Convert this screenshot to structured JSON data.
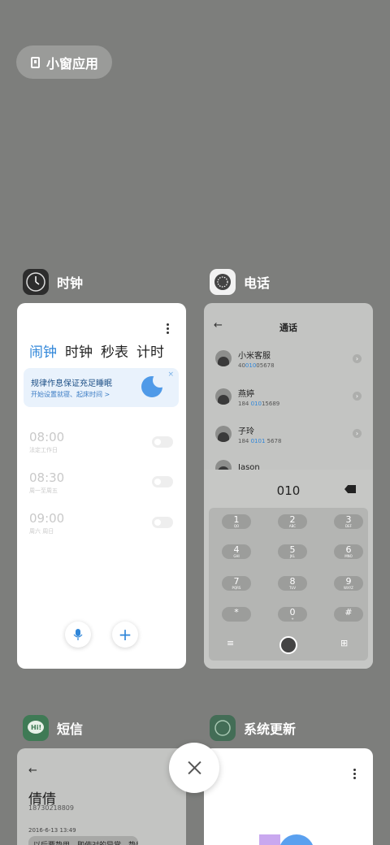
{
  "float_window": {
    "label": "小窗应用"
  },
  "apps": {
    "clock": {
      "name": "时钟"
    },
    "phone": {
      "name": "电话"
    },
    "sms": {
      "name": "短信"
    },
    "update": {
      "name": "系统更新"
    }
  },
  "clock_card": {
    "tabs": [
      "闹钟",
      "时钟",
      "秒表",
      "计时"
    ],
    "active_tab": "闹钟",
    "banner": {
      "title": "规律作息保证充足睡眠",
      "subtitle": "开始设置就寝、起床时间 >",
      "close": "×"
    },
    "alarms": [
      {
        "time": "08:00",
        "repeat": "法定工作日",
        "enabled": false
      },
      {
        "time": "08:30",
        "repeat": "周一至周五",
        "enabled": false
      },
      {
        "time": "09:00",
        "repeat": "周六 周日",
        "enabled": false
      }
    ],
    "add_label": "+"
  },
  "phone_card": {
    "back": "←",
    "title": "通话",
    "contacts": [
      {
        "name": "小米客服",
        "num_pre": "40",
        "num_hl": "010",
        "num_post": "05678"
      },
      {
        "name": "燕婷",
        "num_pre": "184 ",
        "num_hl": "010",
        "num_post": "15689"
      },
      {
        "name": "子玲",
        "num_pre": "184 ",
        "num_hl": "0101",
        "num_post": " 5678"
      },
      {
        "name": "Jason",
        "num_pre": "",
        "num_hl": "",
        "num_post": ""
      }
    ],
    "dialed": "010",
    "keys": [
      {
        "d": "1",
        "l": "QO"
      },
      {
        "d": "2",
        "l": "ABC"
      },
      {
        "d": "3",
        "l": "DEF"
      },
      {
        "d": "4",
        "l": "GHI"
      },
      {
        "d": "5",
        "l": "JKL"
      },
      {
        "d": "6",
        "l": "MNO"
      },
      {
        "d": "7",
        "l": "PQRS"
      },
      {
        "d": "8",
        "l": "TUV"
      },
      {
        "d": "9",
        "l": "WXYZ"
      },
      {
        "d": "*",
        "l": ""
      },
      {
        "d": "0",
        "l": "+"
      },
      {
        "d": "#",
        "l": ""
      }
    ],
    "menu": "≡",
    "hide": "⊞"
  },
  "sms_card": {
    "back": "←",
    "contact_name": "倩倩",
    "phone": "18730218809",
    "date": "2016-6-13 13:49",
    "preview": "以后要挚用，即使对的异常，挚用"
  }
}
